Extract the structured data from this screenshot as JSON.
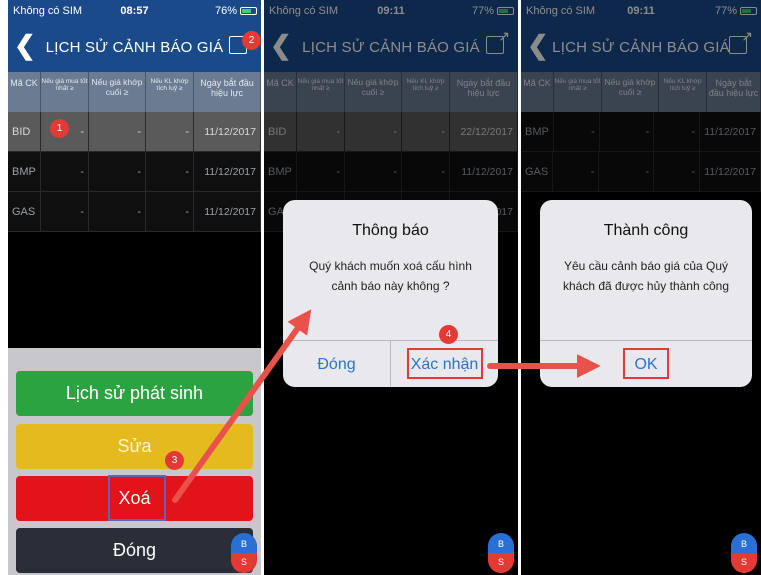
{
  "header_title": "LỊCH SỬ CẢNH BÁO GIÁ",
  "table_headers": [
    "Mã CK",
    "Nếu giá mua tốt nhất ≥",
    "Nếu giá khớp cuối ≥",
    "Nếu KL khớp tích luỹ ≥",
    "Ngày bắt đầu hiệu lực"
  ],
  "screens": [
    {
      "status": {
        "carrier": "Không có SIM",
        "time": "08:57",
        "battery": "76%"
      },
      "rows": [
        {
          "code": "BID",
          "c2": "-",
          "c3": "-",
          "c4": "-",
          "date": "11/12/2017"
        },
        {
          "code": "BMP",
          "c2": "-",
          "c3": "-",
          "c4": "-",
          "date": "11/12/2017"
        },
        {
          "code": "GAS",
          "c2": "-",
          "c3": "-",
          "c4": "-",
          "date": "11/12/2017"
        }
      ],
      "actions": {
        "history": "Lịch sử phát sinh",
        "edit": "Sửa",
        "delete": "Xoá",
        "close": "Đóng"
      }
    },
    {
      "status": {
        "carrier": "Không có SIM",
        "time": "09:11",
        "battery": "77%"
      },
      "rows": [
        {
          "code": "BID",
          "c2": "-",
          "c3": "-",
          "c4": "-",
          "date": "22/12/2017"
        },
        {
          "code": "BMP",
          "c2": "-",
          "c3": "-",
          "c4": "-",
          "date": "11/12/2017"
        },
        {
          "code": "GAS",
          "c2": "",
          "c3": "",
          "c4": "",
          "date": "11/12/2017"
        }
      ],
      "dialog": {
        "title": "Thông báo",
        "message": "Quý khách muốn xoá cấu hình cảnh báo này không ?",
        "cancel": "Đóng",
        "confirm": "Xác nhận"
      }
    },
    {
      "status": {
        "carrier": "Không có SIM",
        "time": "09:11",
        "battery": "77%"
      },
      "rows": [
        {
          "code": "BMP",
          "c2": "-",
          "c3": "-",
          "c4": "-",
          "date": "11/12/2017"
        },
        {
          "code": "GAS",
          "c2": "-",
          "c3": "-",
          "c4": "-",
          "date": "11/12/2017"
        }
      ],
      "dialog": {
        "title": "Thành công",
        "message": "Yêu cầu cảnh báo giá của Quý khách đã được hủy thành công",
        "ok": "OK"
      }
    }
  ],
  "markers": [
    "1",
    "2",
    "3",
    "4"
  ],
  "bs_widget": {
    "buy": "B",
    "sell": "S"
  },
  "colors": {
    "header": "#1a4a8a",
    "history_button": "#2aa340",
    "edit_button": "#e5ba1f",
    "delete_button": "#e3131a",
    "close_button": "#2a2e38",
    "marker": "#e53935",
    "arrow": "#e8524a",
    "dialog_link": "#2a72d6"
  }
}
